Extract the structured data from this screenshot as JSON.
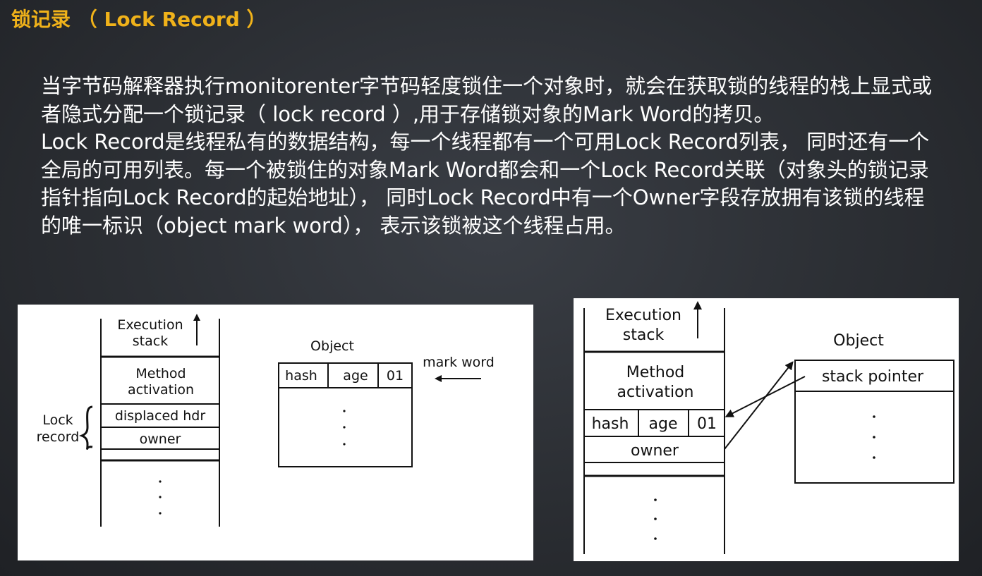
{
  "title": "锁记录 （ Lock Record ）",
  "paragraphs": [
    "当字节码解释器执行monitorenter字节码轻度锁住一个对象时，就会在获取锁的线程的栈上显式或者隐式分配一个锁记录（ lock record ）,用于存储锁对象的Mark Word的拷贝。",
    "Lock Record是线程私有的数据结构，每一个线程都有一个可用Lock Record列表， 同时还有一个全局的可用列表。每一个被锁住的对象Mark Word都会和一个Lock Record关联（对象头的锁记录指针指向Lock Record的起始地址）， 同时Lock Record中有一个Owner字段存放拥有该锁的线程的唯一标识（object mark word）， 表示该锁被这个线程占用。"
  ],
  "diagram_left": {
    "stack_label_line1": "Execution",
    "stack_label_line2": "stack",
    "method_line1": "Method",
    "method_line2": "activation",
    "displaced_hdr": "displaced hdr",
    "owner": "owner",
    "lock_label_line1": "Lock",
    "lock_label_line2": "record",
    "object_label": "Object",
    "mark_word_label": "mark word",
    "cells": [
      "hash",
      "age",
      "01"
    ]
  },
  "diagram_right": {
    "stack_label_line1": "Execution",
    "stack_label_line2": "stack",
    "method_line1": "Method",
    "method_line2": "activation",
    "cells": [
      "hash",
      "age",
      "01"
    ],
    "owner": "owner",
    "object_label": "Object",
    "stack_pointer": "stack pointer"
  }
}
